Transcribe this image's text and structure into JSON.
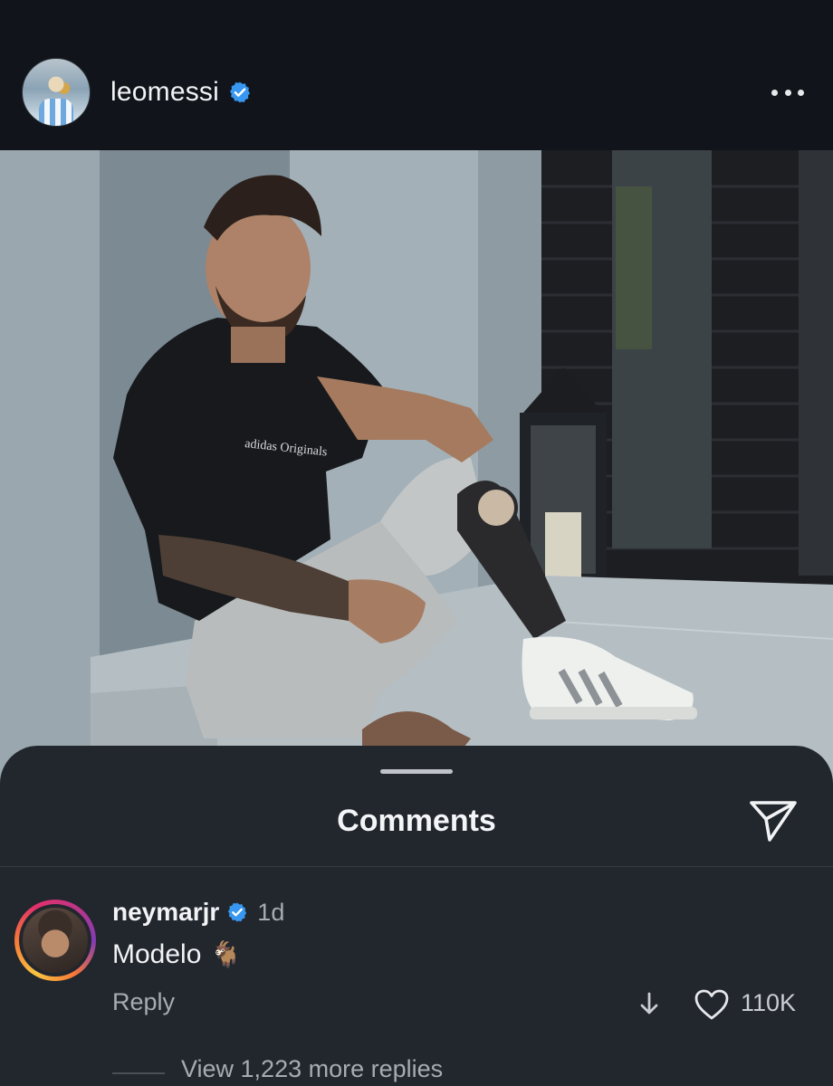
{
  "post": {
    "username": "leomessi",
    "verified": true
  },
  "photo": {
    "shirt_print": "adidas Originals"
  },
  "comments_sheet": {
    "title": "Comments",
    "comment": {
      "username": "neymarjr",
      "verified": true,
      "time": "1d",
      "text": "Modelo",
      "emoji": "🐐",
      "reply_label": "Reply",
      "like_count": "110K"
    },
    "view_replies_label": "View 1,223 more replies"
  },
  "colors": {
    "verified_blue": "#3897f0",
    "sheet_bg": "#22262d",
    "header_bg": "#11151b"
  }
}
